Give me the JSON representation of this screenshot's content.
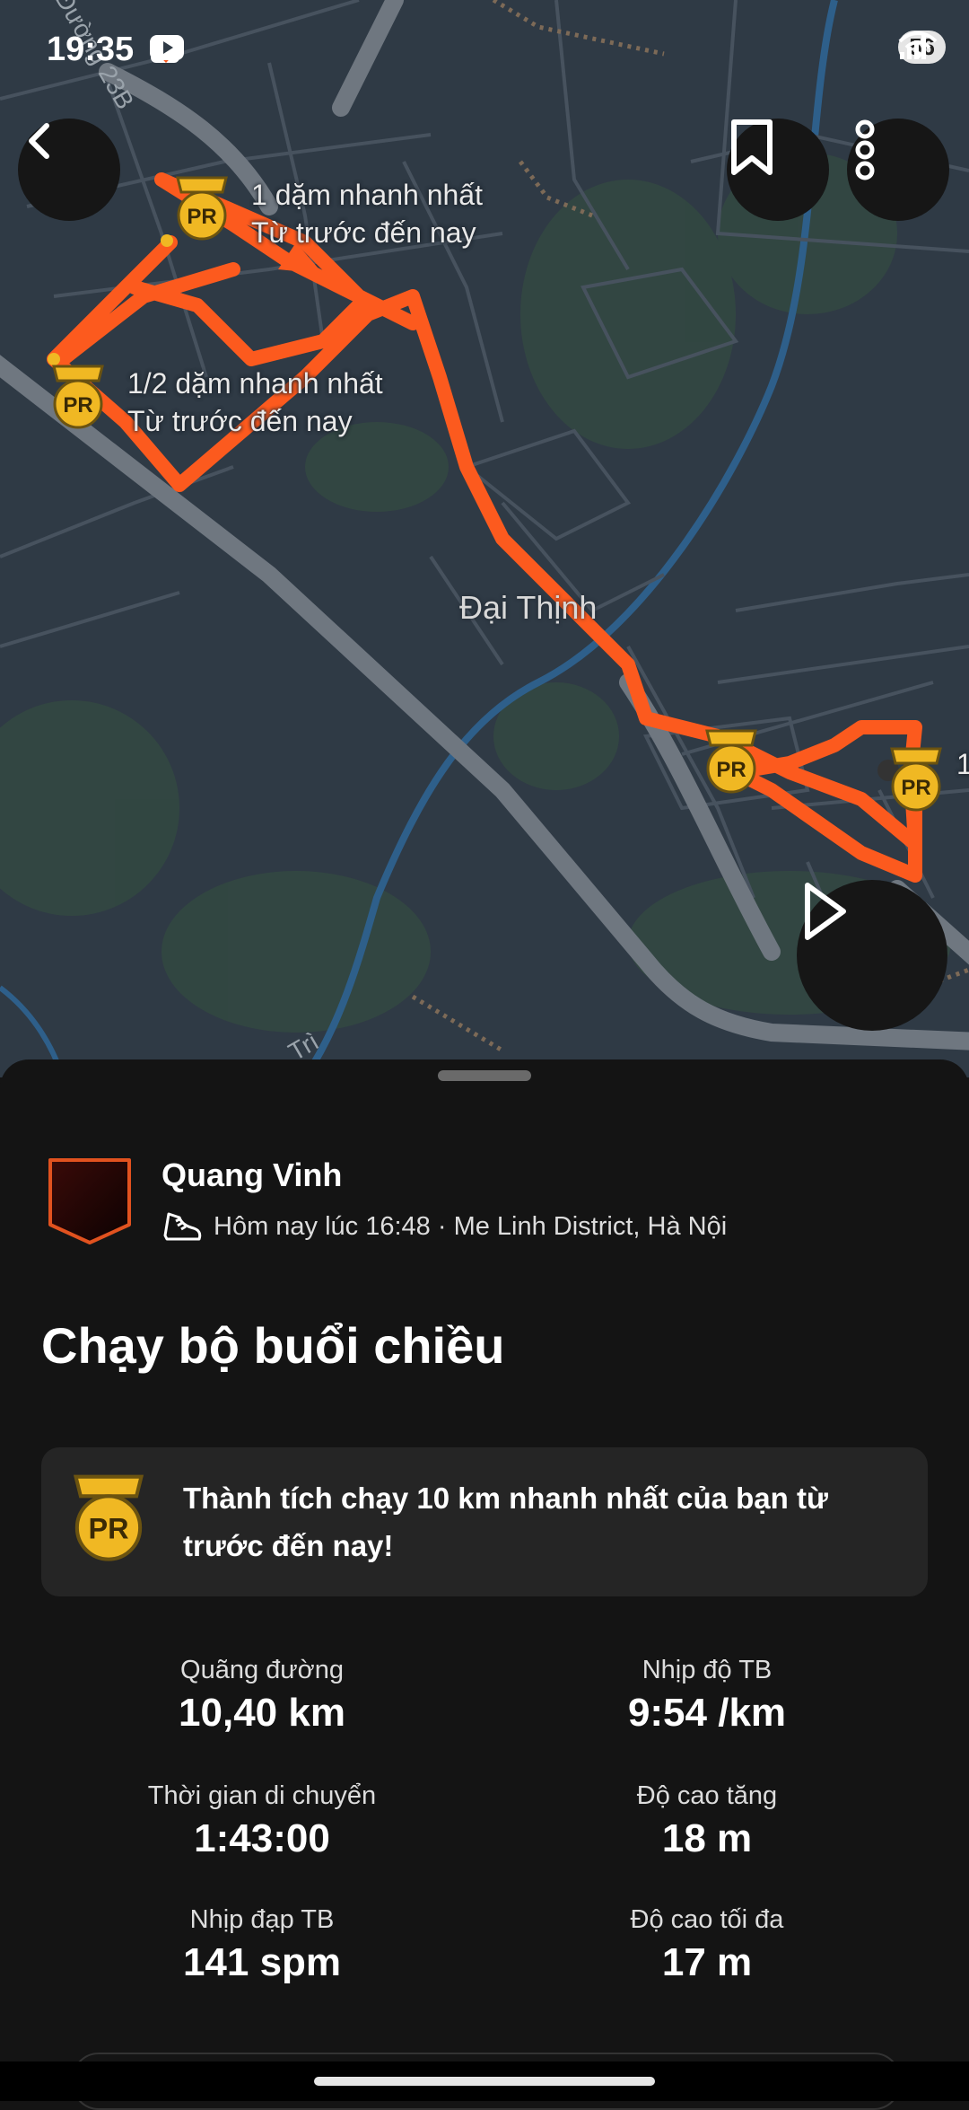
{
  "status_bar": {
    "time": "19:35",
    "battery": "56",
    "icons_left": [
      "screenshot-icon",
      "strava-heart-icon",
      "youtube-icon",
      "dot-icon"
    ],
    "icons_right": [
      "wifi-icon",
      "signal-icon"
    ]
  },
  "map": {
    "route_color": "#fc5a1e",
    "badge_color": "#f0b823",
    "pr_text": "PR",
    "road_label": "Đường 23B",
    "road_label_bottom": "Trì",
    "place_label": "Đại Thịnh",
    "pr_labels": [
      {
        "title": "1 dặm nhanh nhất",
        "subtitle": "Từ trước đến nay"
      },
      {
        "title": "1/2 dặm nhanh nhất",
        "subtitle": "Từ trước đến nay"
      }
    ],
    "edge_label": "1",
    "buttons": {
      "back": "back-arrow-icon",
      "bookmark": "bookmark-icon",
      "more": "more-vertical-icon",
      "play": "play-icon"
    }
  },
  "activity": {
    "athlete_name": "Quang Vinh",
    "meta": "Hôm nay lúc 16:48 · Me Linh District, Hà Nội",
    "sport_icon": "shoe-icon",
    "title": "Chạy bộ buổi chiều",
    "achievement": "Thành tích chạy 10 km nhanh nhất của bạn từ trước đến nay!",
    "stats": [
      {
        "label": "Quãng đường",
        "value": "10,40 km"
      },
      {
        "label": "Nhịp độ TB",
        "value": "9:54 /km"
      },
      {
        "label": "Thời gian di chuyển",
        "value": "1:43:00"
      },
      {
        "label": "Độ cao tăng",
        "value": "18 m"
      },
      {
        "label": "Nhịp đạp TB",
        "value": "141 spm"
      },
      {
        "label": "Độ cao tối đa",
        "value": "17 m"
      }
    ]
  }
}
